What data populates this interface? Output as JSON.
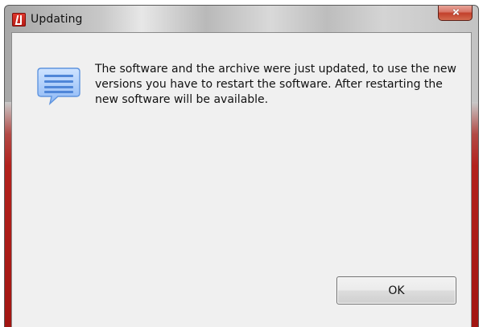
{
  "window": {
    "title": "Updating"
  },
  "message": {
    "text": "The software and the archive were just updated, to use the new versions you have to restart the software. After restarting the new software will be available.",
    "icon": "message-balloon-icon"
  },
  "buttons": {
    "ok_label": "OK"
  },
  "titlebar": {
    "app_icon": "app-logo-icon",
    "close_icon": "close-icon"
  },
  "colors": {
    "dialog_background": "#f0f0f0",
    "close_button": "#c2402b",
    "frame_red": "#b2221d"
  }
}
